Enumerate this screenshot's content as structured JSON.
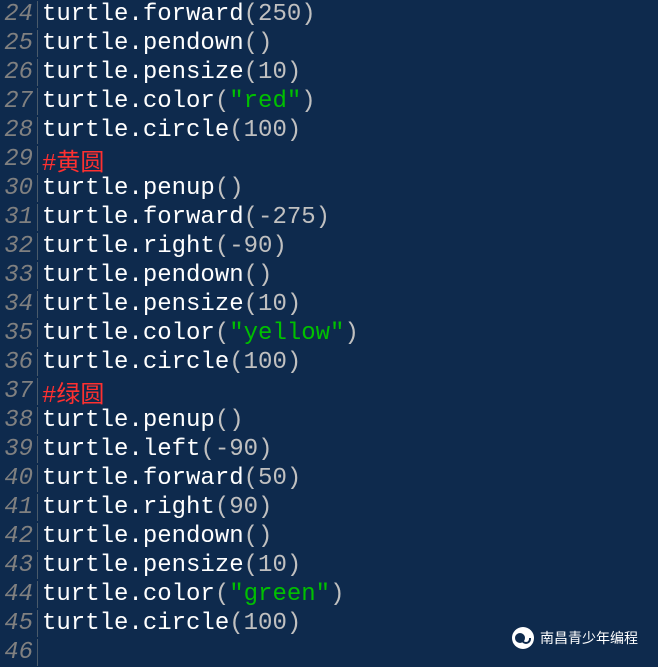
{
  "lines": [
    {
      "num": "24",
      "tokens": [
        {
          "cls": "fn",
          "t": "turtle.forward"
        },
        {
          "cls": "paren",
          "t": "("
        },
        {
          "cls": "num",
          "t": "250"
        },
        {
          "cls": "paren",
          "t": ")"
        }
      ]
    },
    {
      "num": "25",
      "tokens": [
        {
          "cls": "fn",
          "t": "turtle.pendown"
        },
        {
          "cls": "paren",
          "t": "()"
        }
      ]
    },
    {
      "num": "26",
      "tokens": [
        {
          "cls": "fn",
          "t": "turtle.pensize"
        },
        {
          "cls": "paren",
          "t": "("
        },
        {
          "cls": "num",
          "t": "10"
        },
        {
          "cls": "paren",
          "t": ")"
        }
      ]
    },
    {
      "num": "27",
      "tokens": [
        {
          "cls": "fn",
          "t": "turtle.color"
        },
        {
          "cls": "paren",
          "t": "("
        },
        {
          "cls": "str",
          "t": "\"red\""
        },
        {
          "cls": "paren",
          "t": ")"
        }
      ]
    },
    {
      "num": "28",
      "tokens": [
        {
          "cls": "fn",
          "t": "turtle.circle"
        },
        {
          "cls": "paren",
          "t": "("
        },
        {
          "cls": "num",
          "t": "100"
        },
        {
          "cls": "paren",
          "t": ")"
        }
      ]
    },
    {
      "num": "29",
      "tokens": [
        {
          "cls": "comment",
          "t": "#黄圆"
        }
      ]
    },
    {
      "num": "30",
      "tokens": [
        {
          "cls": "fn",
          "t": "turtle.penup"
        },
        {
          "cls": "paren",
          "t": "()"
        }
      ]
    },
    {
      "num": "31",
      "tokens": [
        {
          "cls": "fn",
          "t": "turtle.forward"
        },
        {
          "cls": "paren",
          "t": "("
        },
        {
          "cls": "num",
          "t": "-275"
        },
        {
          "cls": "paren",
          "t": ")"
        }
      ]
    },
    {
      "num": "32",
      "tokens": [
        {
          "cls": "fn",
          "t": "turtle.right"
        },
        {
          "cls": "paren",
          "t": "("
        },
        {
          "cls": "num",
          "t": "-90"
        },
        {
          "cls": "paren",
          "t": ")"
        }
      ]
    },
    {
      "num": "33",
      "tokens": [
        {
          "cls": "fn",
          "t": "turtle.pendown"
        },
        {
          "cls": "paren",
          "t": "()"
        }
      ]
    },
    {
      "num": "34",
      "tokens": [
        {
          "cls": "fn",
          "t": "turtle.pensize"
        },
        {
          "cls": "paren",
          "t": "("
        },
        {
          "cls": "num",
          "t": "10"
        },
        {
          "cls": "paren",
          "t": ")"
        }
      ]
    },
    {
      "num": "35",
      "tokens": [
        {
          "cls": "fn",
          "t": "turtle.color"
        },
        {
          "cls": "paren",
          "t": "("
        },
        {
          "cls": "str",
          "t": "\"yellow\""
        },
        {
          "cls": "paren",
          "t": ")"
        }
      ]
    },
    {
      "num": "36",
      "tokens": [
        {
          "cls": "fn",
          "t": "turtle.circle"
        },
        {
          "cls": "paren",
          "t": "("
        },
        {
          "cls": "num",
          "t": "100"
        },
        {
          "cls": "paren",
          "t": ")"
        }
      ]
    },
    {
      "num": "37",
      "tokens": [
        {
          "cls": "comment",
          "t": "#绿圆"
        }
      ]
    },
    {
      "num": "38",
      "tokens": [
        {
          "cls": "fn",
          "t": "turtle.penup"
        },
        {
          "cls": "paren",
          "t": "()"
        }
      ]
    },
    {
      "num": "39",
      "tokens": [
        {
          "cls": "fn",
          "t": "turtle.left"
        },
        {
          "cls": "paren",
          "t": "("
        },
        {
          "cls": "num",
          "t": "-90"
        },
        {
          "cls": "paren",
          "t": ")"
        }
      ]
    },
    {
      "num": "40",
      "tokens": [
        {
          "cls": "fn",
          "t": "turtle.forward"
        },
        {
          "cls": "paren",
          "t": "("
        },
        {
          "cls": "num",
          "t": "50"
        },
        {
          "cls": "paren",
          "t": ")"
        }
      ]
    },
    {
      "num": "41",
      "tokens": [
        {
          "cls": "fn",
          "t": "turtle.right"
        },
        {
          "cls": "paren",
          "t": "("
        },
        {
          "cls": "num",
          "t": "90"
        },
        {
          "cls": "paren",
          "t": ")"
        }
      ]
    },
    {
      "num": "42",
      "tokens": [
        {
          "cls": "fn",
          "t": "turtle.pendown"
        },
        {
          "cls": "paren",
          "t": "()"
        }
      ]
    },
    {
      "num": "43",
      "tokens": [
        {
          "cls": "fn",
          "t": "turtle.pensize"
        },
        {
          "cls": "paren",
          "t": "("
        },
        {
          "cls": "num",
          "t": "10"
        },
        {
          "cls": "paren",
          "t": ")"
        }
      ]
    },
    {
      "num": "44",
      "tokens": [
        {
          "cls": "fn",
          "t": "turtle.color"
        },
        {
          "cls": "paren",
          "t": "("
        },
        {
          "cls": "str",
          "t": "\"green\""
        },
        {
          "cls": "paren",
          "t": ")"
        }
      ]
    },
    {
      "num": "45",
      "tokens": [
        {
          "cls": "fn",
          "t": "turtle.circle"
        },
        {
          "cls": "paren",
          "t": "("
        },
        {
          "cls": "num",
          "t": "100"
        },
        {
          "cls": "paren",
          "t": ")"
        }
      ]
    },
    {
      "num": "46",
      "tokens": []
    }
  ],
  "watermark": "南昌青少年编程"
}
